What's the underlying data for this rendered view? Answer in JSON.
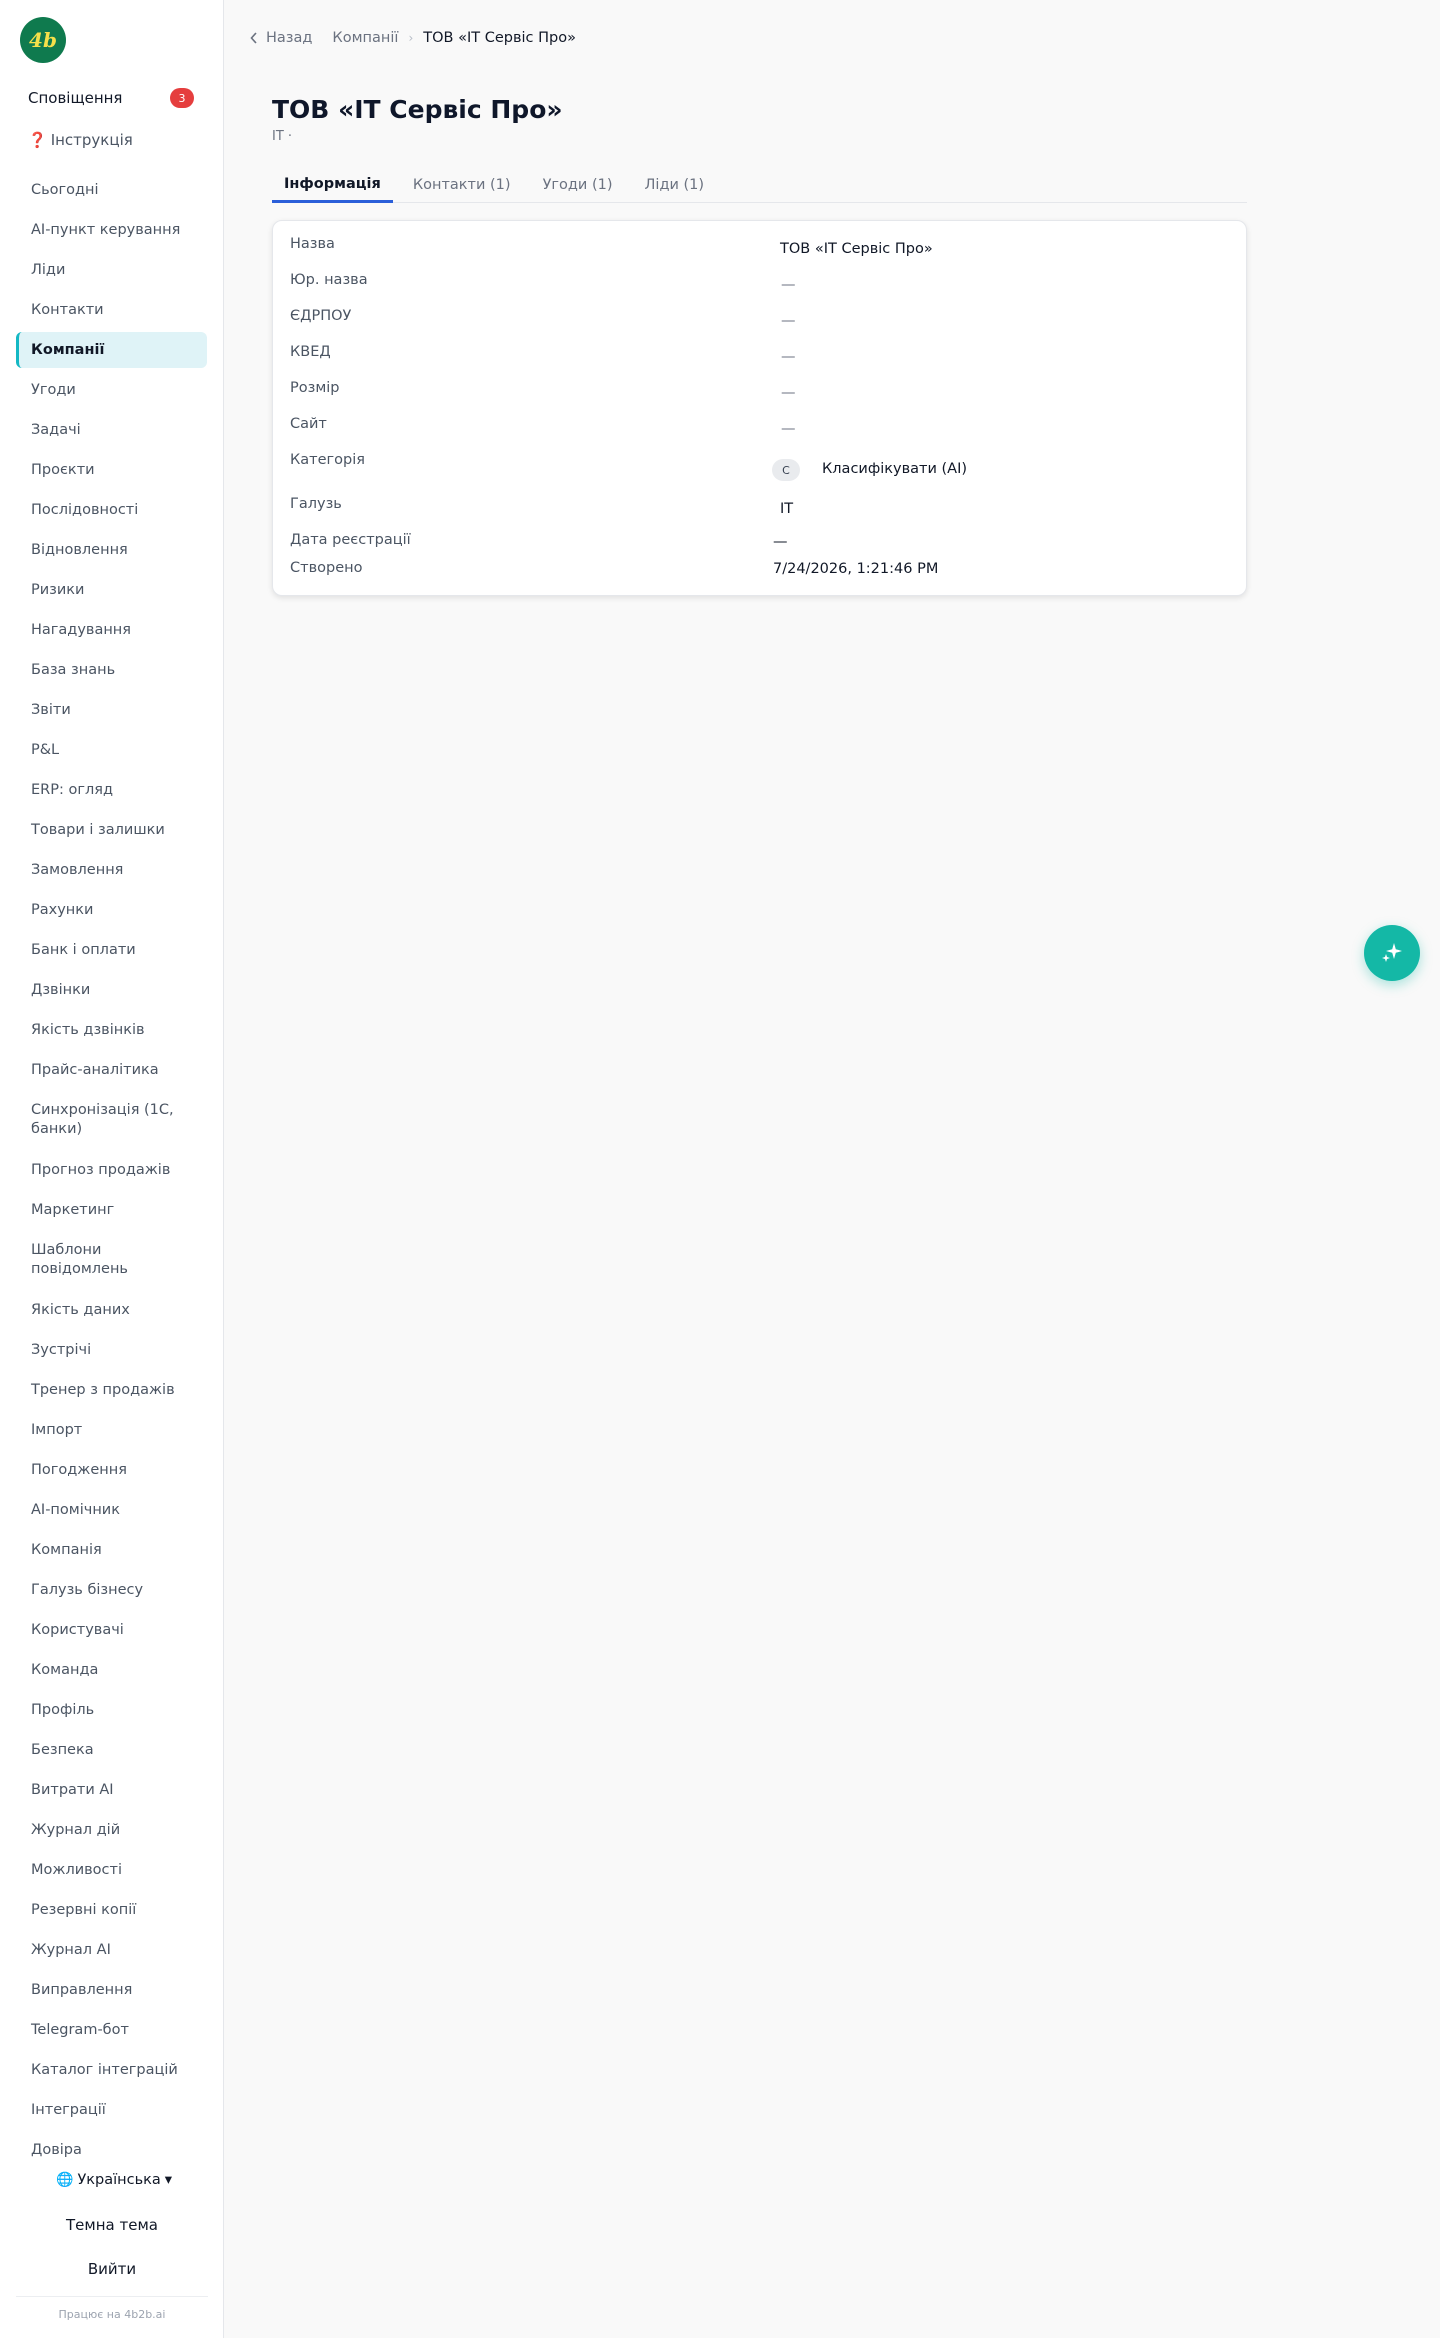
{
  "brand": {
    "logo_text": "4b",
    "logo_color": "#0f7a4e",
    "powered_by": "Працює на 4b2b.ai"
  },
  "sidebar": {
    "notifications_label": "Сповіщення",
    "notifications_count": "3",
    "help_icon": "❓",
    "help_label": "Інструкція",
    "items": [
      {
        "label": "Сьогодні"
      },
      {
        "label": "AI-пункт керування"
      },
      {
        "label": "Ліди"
      },
      {
        "label": "Контакти"
      },
      {
        "label": "Компанії",
        "active": true
      },
      {
        "label": "Угоди"
      },
      {
        "label": "Задачі"
      },
      {
        "label": "Проєкти"
      },
      {
        "label": "Послідовності"
      },
      {
        "label": "Відновлення"
      },
      {
        "label": "Ризики"
      },
      {
        "label": "Нагадування"
      },
      {
        "label": "База знань"
      },
      {
        "label": "Звіти"
      },
      {
        "label": "P&L"
      },
      {
        "label": "ERP: огляд"
      },
      {
        "label": "Товари і залишки"
      },
      {
        "label": "Замовлення"
      },
      {
        "label": "Рахунки"
      },
      {
        "label": "Банк і оплати"
      },
      {
        "label": "Дзвінки"
      },
      {
        "label": "Якість дзвінків"
      },
      {
        "label": "Прайс-аналітика"
      },
      {
        "label": "Синхронізація (1С, банки)"
      },
      {
        "label": "Прогноз продажів"
      },
      {
        "label": "Маркетинг"
      },
      {
        "label": "Шаблони повідомлень"
      },
      {
        "label": "Якість даних"
      },
      {
        "label": "Зустрічі"
      },
      {
        "label": "Тренер з продажів"
      },
      {
        "label": "Імпорт"
      },
      {
        "label": "Погодження"
      },
      {
        "label": "AI-помічник"
      },
      {
        "label": "Компанія"
      },
      {
        "label": "Галузь бізнесу"
      },
      {
        "label": "Користувачі"
      },
      {
        "label": "Команда"
      },
      {
        "label": "Профіль"
      },
      {
        "label": "Безпека"
      },
      {
        "label": "Витрати AI"
      },
      {
        "label": "Журнал дій"
      },
      {
        "label": "Можливості"
      },
      {
        "label": "Резервні копії"
      },
      {
        "label": "Журнал AI"
      },
      {
        "label": "Виправлення"
      },
      {
        "label": "Telegram-бот"
      },
      {
        "label": "Каталог інтеграцій"
      },
      {
        "label": "Інтеграції"
      },
      {
        "label": "Довіра"
      }
    ],
    "language_icon": "🌐",
    "language": "Українська",
    "language_caret": "▾",
    "dark_theme": "Темна тема",
    "logout": "Вийти"
  },
  "breadcrumb": {
    "back": "Назад",
    "section": "Компанії",
    "current": "ТОВ «IT Сервіс Про»"
  },
  "page": {
    "title": "ТОВ «IT Сервіс Про»",
    "subtitle": "IT ·"
  },
  "tabs": [
    {
      "label": "Інформація",
      "active": true
    },
    {
      "label": "Контакти (1)"
    },
    {
      "label": "Угоди (1)"
    },
    {
      "label": "Ліди (1)"
    }
  ],
  "info": {
    "fields": [
      {
        "label": "Назва",
        "value": "ТОВ «IT Сервіс Про»"
      },
      {
        "label": "Юр. назва",
        "value": "—"
      },
      {
        "label": "ЄДРПОУ",
        "value": "—"
      },
      {
        "label": "КВЕД",
        "value": "—"
      },
      {
        "label": "Розмір",
        "value": "—"
      },
      {
        "label": "Сайт",
        "value": "—"
      },
      {
        "label": "Категорія",
        "chip": "C",
        "value": "Класифікувати (AI)"
      },
      {
        "label": "Галузь",
        "value": "IT"
      },
      {
        "label": "Дата реєстрації",
        "value": "—"
      },
      {
        "label": "Створено",
        "value": "7/24/2026, 1:21:46 PM"
      }
    ]
  },
  "fab": {
    "icon": "sparkles-icon",
    "color": "#14b8a6"
  },
  "colors": {
    "accent": "#14b8c4",
    "tab_underline": "#2b5fd9",
    "badge": "#e53e3e"
  }
}
